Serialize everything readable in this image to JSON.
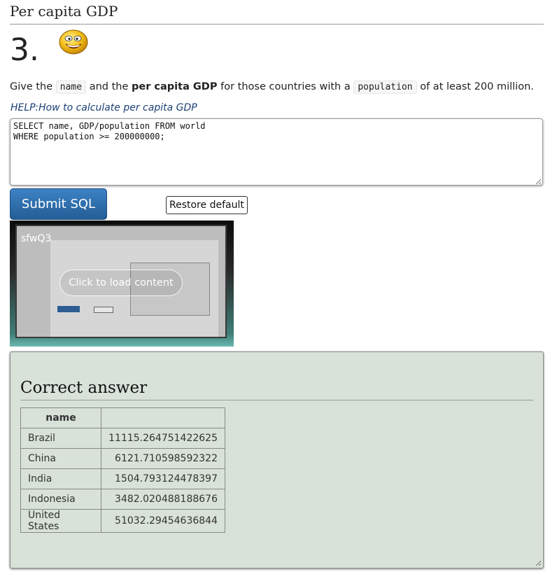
{
  "page": {
    "heading": "Per capita GDP",
    "question_number": "3."
  },
  "question": {
    "text_1": "Give the ",
    "code_1": "name",
    "text_2": " and the ",
    "bold_1": "per capita GDP",
    "text_3": " for those countries with a ",
    "code_2": "population",
    "text_4": " of at least 200 million."
  },
  "help_link": "HELP:How to calculate per capita GDP",
  "editor": {
    "sql": "SELECT name, GDP/population FROM world\nWHERE population >= 200000000;"
  },
  "buttons": {
    "submit": "Submit SQL",
    "restore": "Restore default"
  },
  "video": {
    "title": "sfwQ3",
    "load_label": "Click to load content"
  },
  "answer": {
    "title": "Correct answer",
    "columns": [
      "name",
      ""
    ],
    "rows": [
      [
        "Brazil",
        "11115.264751422625"
      ],
      [
        "China",
        "6121.710598592322"
      ],
      [
        "India",
        "1504.793124478397"
      ],
      [
        "Indonesia",
        "3482.020488188676"
      ],
      [
        "United States",
        "51032.29454636844"
      ]
    ]
  },
  "colors": {
    "accent": "#2c6aa6",
    "link": "#1b3f73",
    "answer_bg": "#d8e2d8"
  },
  "icons": [
    "smiley-icon",
    "resize-grip-icon"
  ]
}
